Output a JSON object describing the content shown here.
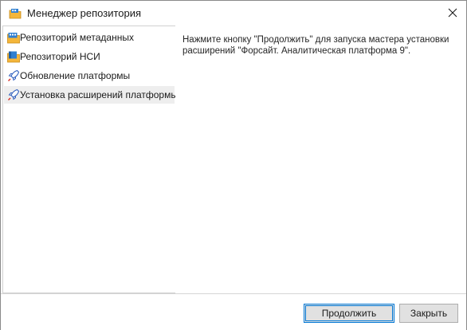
{
  "window": {
    "title": "Менеджер репозитория"
  },
  "nav": {
    "items": [
      {
        "label": "Репозиторий метаданных",
        "icon": "metadata-repository-icon"
      },
      {
        "label": "Репозиторий НСИ",
        "icon": "nsi-repository-icon"
      },
      {
        "label": "Обновление платформы",
        "icon": "platform-update-icon"
      },
      {
        "label": "Установка расширений платформы",
        "icon": "extensions-install-icon"
      }
    ],
    "selected_index": 3
  },
  "content": {
    "message": "Нажмите кнопку \"Продолжить\" для запуска мастера установки расширений \"Форсайт. Аналитическая платформа 9\"."
  },
  "footer": {
    "continue_label": "Продолжить",
    "close_label": "Закрыть"
  },
  "colors": {
    "accent": "#0078d7",
    "selection": "#eeeeee"
  }
}
